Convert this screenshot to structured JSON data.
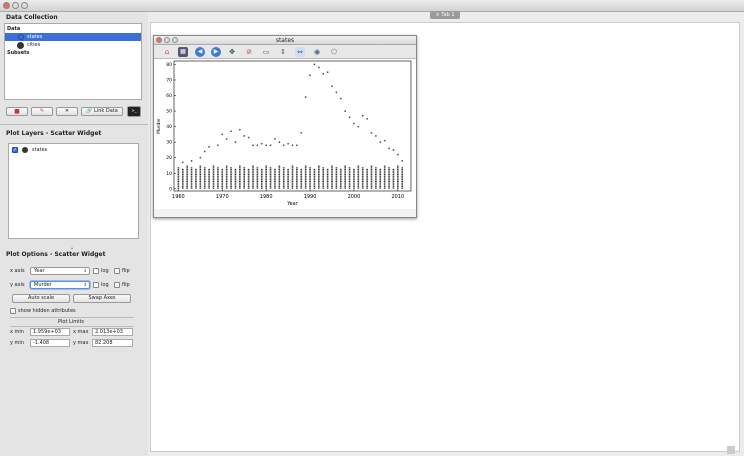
{
  "data_collection": {
    "title": "Data Collection",
    "tree": {
      "data_label": "Data",
      "items": [
        "states",
        "cities"
      ],
      "subsets_label": "Subsets"
    },
    "buttons": {
      "link": "Link Data"
    }
  },
  "plot_layers": {
    "title": "Plot Layers - Scatter Widget",
    "layer": "states"
  },
  "plot_options": {
    "title": "Plot Options - Scatter Widget",
    "x_axis": {
      "label": "x axis",
      "value": "Year"
    },
    "y_axis": {
      "label": "y axis",
      "value": "Murder"
    },
    "log_label": "log",
    "flip_label": "flip",
    "autoscale": "Auto scale",
    "swap": "Swap Axes",
    "show_hidden": "show hidden attributes",
    "limits_title": "Plot Limits",
    "xmin_label": "x min",
    "xmin": "1.959e+03",
    "xmax_label": "x max",
    "xmax": "2.013e+03",
    "ymin_label": "y min",
    "ymin": "-1.408",
    "ymax_label": "y max",
    "ymax": "82.208"
  },
  "tab": {
    "label": "Tab 1"
  },
  "window": {
    "title": "states"
  },
  "chart_data": {
    "type": "scatter",
    "xlabel": "Year",
    "ylabel": "Murder",
    "xlim": [
      1959,
      2013
    ],
    "ylim": [
      -1.408,
      82.208
    ],
    "xticks": [
      "1960",
      "1970",
      "1980",
      "1990",
      "2000",
      "2010"
    ],
    "yticks": [
      "0",
      "10",
      "20",
      "30",
      "40",
      "50",
      "60",
      "70",
      "80"
    ],
    "outliers": {
      "x": [
        1961,
        1963,
        1965,
        1966,
        1967,
        1969,
        1970,
        1971,
        1972,
        1973,
        1974,
        1975,
        1976,
        1977,
        1978,
        1979,
        1980,
        1981,
        1982,
        1983,
        1984,
        1985,
        1986,
        1987,
        1988,
        1989,
        1990,
        1991,
        1992,
        1993,
        1994,
        1995,
        1996,
        1997,
        1998,
        1999,
        2000,
        2001,
        2002,
        2003,
        2004,
        2005,
        2006,
        2007,
        2008,
        2009,
        2010,
        2011
      ],
      "y": [
        17,
        18,
        20,
        24,
        27,
        28,
        35,
        32,
        37,
        30,
        38,
        34,
        33,
        28,
        28,
        29,
        28,
        28,
        32,
        30,
        28,
        29,
        28,
        28,
        36,
        59,
        73,
        80,
        78,
        74,
        75,
        66,
        62,
        58,
        50,
        46,
        42,
        40,
        47,
        45,
        36,
        34,
        30,
        31,
        26,
        25,
        22,
        18
      ]
    },
    "band": {
      "x_start": 1960,
      "x_end": 2011,
      "y_low": 0,
      "y_high": 15
    }
  }
}
